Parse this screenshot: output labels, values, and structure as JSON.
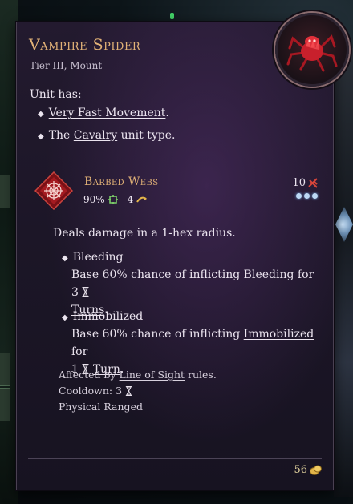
{
  "unit": {
    "name": "Vampire Spider",
    "subtitle": "Tier III, Mount",
    "portrait_icon": "vampire-spider-portrait-icon"
  },
  "traits": {
    "header": "Unit has:",
    "items": [
      {
        "link": "Very Fast Movement",
        "suffix": "."
      },
      {
        "prefix": "The ",
        "link": "Cavalry",
        "suffix": " unit type."
      }
    ]
  },
  "ability": {
    "name": "Barbed Webs",
    "accuracy": "90%",
    "range": "4",
    "damage": "10",
    "action_points": 3,
    "icon": "barbed-webs-icon",
    "description": "Deals damage in a 1-hex radius.",
    "effects": [
      {
        "name": "Bleeding",
        "line1_prefix": "Base 60% chance of inflicting ",
        "line1_link": "Bleeding",
        "line1_suffix": " for 3",
        "line2_link": "Turns",
        "line2_suffix": "."
      },
      {
        "name": "Immobilized",
        "line1_prefix": "Base 60% chance of inflicting ",
        "line1_link": "Immobilized",
        "line1_suffix": " for",
        "line2_prefix": "1",
        "line2_link": "Turn",
        "line2_suffix": "."
      }
    ],
    "los_prefix": "Affected by ",
    "los_link": "Line of Sight",
    "los_suffix": " rules.",
    "cooldown": "Cooldown: 3",
    "tags": "Physical Ranged"
  },
  "footer": {
    "gold": "56"
  },
  "colors": {
    "title": "#e2b277",
    "text": "#ebe4ef",
    "damage_icon": "#d8453a",
    "ap_dot": "#bcd8f4",
    "gold": "#e7d7a1"
  }
}
